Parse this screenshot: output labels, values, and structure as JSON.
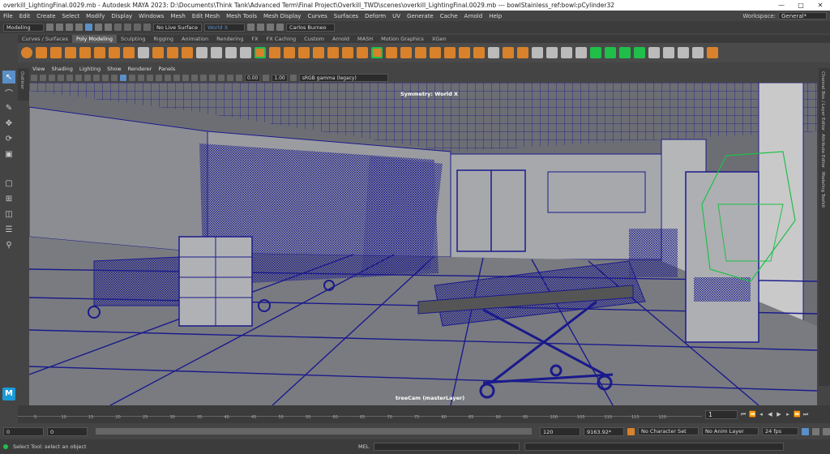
{
  "window": {
    "title": "overkill_LightingFinal.0029.mb - Autodesk MAYA 2023: D:\\Documents\\Think Tank\\Advanced Term\\Final Project\\Overkill_TWD\\scenes\\overkill_LightingFinal.0029.mb --- bowlStainless_ref:bowl:pCylinder32",
    "minimize": "—",
    "maximize": "□",
    "close": "✕"
  },
  "menu": {
    "items": [
      "File",
      "Edit",
      "Create",
      "Select",
      "Modify",
      "Display",
      "Windows",
      "Mesh",
      "Edit Mesh",
      "Mesh Tools",
      "Mesh Display",
      "Curves",
      "Surfaces",
      "Deform",
      "UV",
      "Generate",
      "Cache",
      "Arnold",
      "Help"
    ],
    "workspace_label": "Workspace:",
    "workspace_value": "General*"
  },
  "statusline": {
    "menuset": "Modeling",
    "live_surface": "No Live Surface",
    "world": "World X",
    "user": "Carlos Burneo"
  },
  "shelf": {
    "tabs": [
      "Curves / Surfaces",
      "Poly Modeling",
      "Sculpting",
      "Rigging",
      "Animation",
      "Rendering",
      "FX",
      "FX Caching",
      "Custom",
      "Arnold",
      "MASH",
      "Motion Graphics",
      "XGen"
    ],
    "active_tab": "Poly Modeling"
  },
  "panel": {
    "menus": [
      "View",
      "Shading",
      "Lighting",
      "Show",
      "Renderer",
      "Panels"
    ],
    "exposure": "0.00",
    "gamma": "1.00",
    "color_space": "sRGB gamma (legacy)",
    "symmetry_label": "Symmetry: World X",
    "camera_label": "treeCam (masterLayer)"
  },
  "side_tabs": {
    "left": "Outliner",
    "right": [
      "Channel Box / Layer Editor",
      "Attribute Editor",
      "Modeling Toolkit"
    ]
  },
  "timeline": {
    "ticks": [
      "5",
      "10",
      "15",
      "20",
      "25",
      "30",
      "35",
      "40",
      "45",
      "50",
      "55",
      "60",
      "65",
      "70",
      "75",
      "80",
      "85",
      "90",
      "95",
      "100",
      "105",
      "110",
      "115",
      "120"
    ],
    "current_frame": "1"
  },
  "range": {
    "start": "0",
    "start_inner": "0",
    "end_inner": "120",
    "end": "9163.92*",
    "character_set": "No Character Set",
    "anim_layer": "No Anim Layer",
    "fps": "24 fps"
  },
  "help": {
    "message": "Select Tool: select an object",
    "mel_label": "MEL"
  },
  "colors": {
    "wire": "#1a1a8c",
    "selected_wire": "#1fbf4a",
    "accent": "#5a8fc7"
  }
}
